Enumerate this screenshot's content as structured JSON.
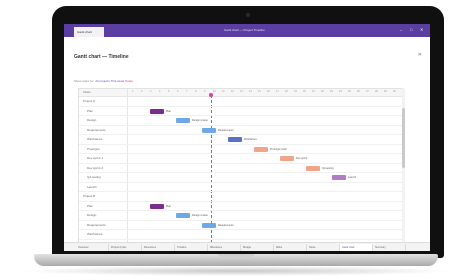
{
  "titlebar": {
    "app_tab_label": "Gantt chart",
    "window_title": "Gantt chart — Project Timeline",
    "minimize_glyph": "–",
    "maximize_glyph": "□",
    "close_glyph": "✕"
  },
  "page": {
    "title": "Gantt chart — Timeline",
    "close_glyph": "✕"
  },
  "filters": {
    "prefix": "Show tasks for:",
    "item1": "All projects",
    "item2": "This week",
    "item3": "Today"
  },
  "grid": {
    "left_header": "Tasks",
    "rows": [
      {
        "label": "Project A",
        "sub": false
      },
      {
        "label": "Plan",
        "sub": true
      },
      {
        "label": "Design",
        "sub": true
      },
      {
        "label": "Requirements",
        "sub": true
      },
      {
        "label": "Wireframes",
        "sub": true
      },
      {
        "label": "Prototype",
        "sub": true
      },
      {
        "label": "Dev sprint 1",
        "sub": true
      },
      {
        "label": "Dev sprint 2",
        "sub": true
      },
      {
        "label": "QA testing",
        "sub": true
      },
      {
        "label": "Launch",
        "sub": true
      },
      {
        "label": "Project B",
        "sub": false
      },
      {
        "label": "Plan",
        "sub": true
      },
      {
        "label": "Design",
        "sub": true
      },
      {
        "label": "Requirements",
        "sub": true
      },
      {
        "label": "Wireframes",
        "sub": true
      }
    ],
    "ticks": [
      "1",
      "2",
      "3",
      "4",
      "5",
      "6",
      "7",
      "8",
      "9",
      "10",
      "11",
      "12",
      "13",
      "14",
      "15",
      "16",
      "17",
      "18",
      "19",
      "20",
      "21",
      "22",
      "23",
      "24",
      "25",
      "26",
      "27",
      "28",
      "29",
      "30"
    ],
    "bars": [
      {
        "label": "Plan",
        "color": "#7a2d8f"
      },
      {
        "label": "Design review",
        "color": "#6fa8e8"
      },
      {
        "label": "Requirements",
        "color": "#6fa8e8"
      },
      {
        "label": "Wireframes",
        "color": "#5b6fc4"
      },
      {
        "label": "Prototype build",
        "color": "#f0a58a"
      },
      {
        "label": "Dev sprint",
        "color": "#f0a58a"
      },
      {
        "label": "QA testing",
        "color": "#f0a58a"
      },
      {
        "label": "Launch",
        "color": "#b07cc8"
      },
      {
        "label": "Plan",
        "color": "#7a2d8f"
      },
      {
        "label": "Design review",
        "color": "#6fa8e8"
      },
      {
        "label": "Requirements",
        "color": "#6fa8e8"
      }
    ]
  },
  "tabs": [
    {
      "label": "Overview",
      "active": false
    },
    {
      "label": "Project A plan",
      "active": false
    },
    {
      "label": "Resources",
      "active": false
    },
    {
      "label": "Timeline",
      "active": false
    },
    {
      "label": "Milestones",
      "active": false
    },
    {
      "label": "Budget",
      "active": false
    },
    {
      "label": "Risks",
      "active": false
    },
    {
      "label": "Notes",
      "active": false
    },
    {
      "label": "Gantt chart",
      "active": true
    },
    {
      "label": "Summary",
      "active": false
    }
  ]
}
